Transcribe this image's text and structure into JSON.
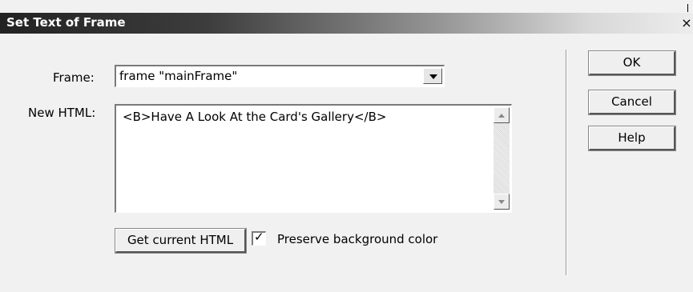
{
  "window": {
    "title": "Set Text of Frame",
    "close_glyph": "×"
  },
  "form": {
    "frame_label": "Frame:",
    "frame_value": "frame \"mainFrame\"",
    "new_html_label": "New HTML:",
    "new_html_value": "<B>Have A Look At the Card's Gallery</B>",
    "get_current_html_label": "Get current HTML",
    "preserve_bg_label": "Preserve background color",
    "preserve_bg_checked": true
  },
  "buttons": {
    "ok": "OK",
    "cancel": "Cancel",
    "help": "Help"
  },
  "icons": {
    "close": "close-icon",
    "dropdown": "chevron-down-icon",
    "scroll_up": "scroll-up-icon",
    "scroll_down": "scroll-down-icon",
    "check": "checkmark-icon"
  }
}
